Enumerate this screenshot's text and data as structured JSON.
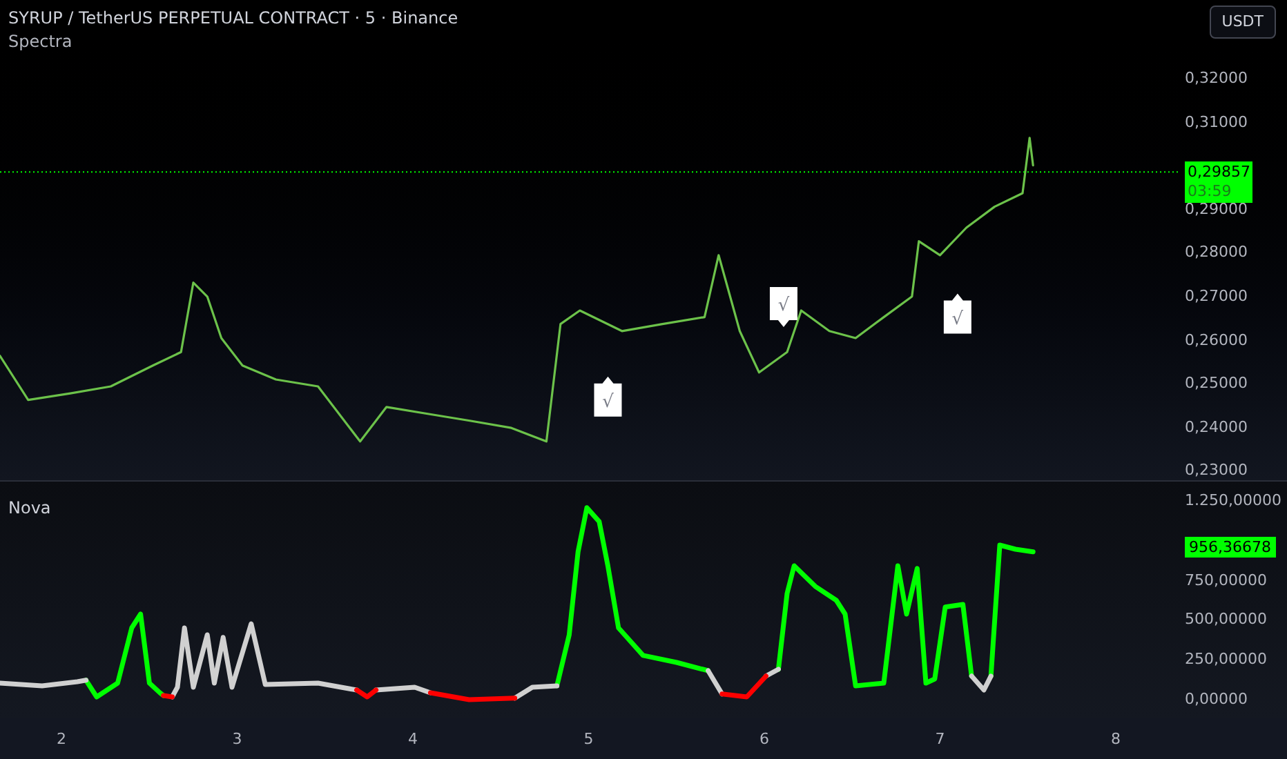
{
  "header": {
    "title": "SYRUP / TetherUS PERPETUAL CONTRACT · 5 · Binance",
    "indicator": "Spectra",
    "currency_button": "USDT"
  },
  "price_pane": {
    "chart_data": {
      "type": "line",
      "x": [
        1.65,
        1.81,
        2.05,
        2.28,
        2.52,
        2.68,
        2.75,
        2.83,
        2.91,
        3.03,
        3.22,
        3.46,
        3.7,
        3.85,
        4.09,
        4.33,
        4.56,
        4.76,
        4.84,
        4.95,
        5.19,
        5.42,
        5.66,
        5.74,
        5.86,
        5.97,
        6.13,
        6.21,
        6.37,
        6.52,
        6.68,
        6.84,
        6.88,
        7.0,
        7.15,
        7.31,
        7.47,
        7.51,
        7.53
      ],
      "series": [
        {
          "color": "#6cc24a",
          "values": [
            0.2564,
            0.2463,
            0.2478,
            0.2494,
            0.2542,
            0.2573,
            0.2732,
            0.27,
            0.2605,
            0.2542,
            0.251,
            0.2494,
            0.2368,
            0.2447,
            0.2431,
            0.2415,
            0.2399,
            0.2368,
            0.2637,
            0.2668,
            0.2621,
            0.2637,
            0.2653,
            0.2795,
            0.2621,
            0.2526,
            0.2573,
            0.2668,
            0.2621,
            0.2605,
            0.2653,
            0.27,
            0.2827,
            0.2795,
            0.2858,
            0.2906,
            0.2937,
            0.3064,
            0.3001
          ]
        }
      ],
      "xlim": [
        1.65,
        8.975
      ],
      "ylim": [
        0.2279,
        0.338
      ],
      "ref_lines": [
        {
          "axis": "y",
          "value": 0.29857,
          "color": "#00ff00"
        }
      ],
      "yticks": [
        {
          "value": 0.32,
          "label": "0,32000"
        },
        {
          "value": 0.31,
          "label": "0,31000"
        },
        {
          "value": 0.29,
          "label": "0,29000"
        },
        {
          "value": 0.28,
          "label": "0,28000"
        },
        {
          "value": 0.27,
          "label": "0,27000"
        },
        {
          "value": 0.26,
          "label": "0,26000"
        },
        {
          "value": 0.25,
          "label": "0,25000"
        },
        {
          "value": 0.24,
          "label": "0,24000"
        },
        {
          "value": 0.23,
          "label": "0,23000"
        }
      ]
    },
    "price_badge": {
      "value": "0,29857",
      "countdown": "03:59",
      "color": "#00ff00"
    },
    "signals": [
      {
        "kind": "up",
        "text": "√"
      },
      {
        "kind": "down",
        "text": "√"
      },
      {
        "kind": "up",
        "text": "√"
      }
    ]
  },
  "indicator_pane": {
    "title": "Nova",
    "chart_data": {
      "type": "line",
      "x": [
        1.65,
        1.89,
        2.09,
        2.14,
        2.2,
        2.32,
        2.4,
        2.45,
        2.5,
        2.56,
        2.58,
        2.63,
        2.66,
        2.7,
        2.75,
        2.83,
        2.87,
        2.92,
        2.97,
        3.08,
        3.16,
        3.46,
        3.68,
        3.74,
        3.79,
        4.01,
        4.1,
        4.32,
        4.58,
        4.68,
        4.82,
        4.89,
        4.94,
        4.99,
        5.06,
        5.11,
        5.17,
        5.31,
        5.5,
        5.68,
        5.76,
        5.9,
        6.01,
        6.08,
        6.13,
        6.17,
        6.29,
        6.41,
        6.46,
        6.52,
        6.68,
        6.76,
        6.81,
        6.87,
        6.92,
        6.97,
        7.03,
        7.13,
        7.18,
        7.25,
        7.29,
        7.34,
        7.43,
        7.53
      ],
      "series": [
        {
          "color": "#00ff00",
          "values": [
            null,
            null,
            null,
            122,
            17,
            104,
            451,
            538,
            104,
            43,
            26,
            null,
            null,
            null,
            null,
            null,
            null,
            null,
            null,
            null,
            null,
            null,
            null,
            null,
            null,
            null,
            null,
            null,
            null,
            null,
            87,
            408,
            929,
            1207,
            1120,
            842,
            451,
            278,
            234,
            182,
            null,
            null,
            null,
            191,
            668,
            842,
            712,
            625,
            538,
            87,
            104,
            842,
            538,
            825,
            104,
            130,
            582,
            599,
            148,
            null,
            148,
            972,
            946,
            929
          ]
        },
        {
          "color": "#d0d0d0",
          "values": [
            104,
            87,
            113,
            122,
            null,
            null,
            null,
            null,
            null,
            null,
            null,
            17,
            78,
            451,
            78,
            408,
            104,
            391,
            78,
            477,
            95,
            104,
            61,
            null,
            61,
            78,
            43,
            null,
            9,
            78,
            87,
            null,
            null,
            null,
            null,
            null,
            null,
            null,
            null,
            182,
            35,
            null,
            148,
            191,
            null,
            null,
            null,
            null,
            null,
            null,
            null,
            null,
            null,
            null,
            null,
            null,
            null,
            null,
            148,
            61,
            148,
            null,
            null,
            null
          ]
        },
        {
          "color": "#ff0000",
          "values": [
            null,
            null,
            null,
            null,
            null,
            null,
            null,
            null,
            null,
            null,
            26,
            17,
            null,
            null,
            null,
            null,
            null,
            null,
            null,
            null,
            null,
            null,
            61,
            17,
            61,
            null,
            43,
            0,
            9,
            null,
            null,
            null,
            null,
            null,
            null,
            null,
            null,
            null,
            null,
            null,
            35,
            17,
            148,
            null,
            null,
            null,
            null,
            null,
            null,
            null,
            null,
            null,
            null,
            null,
            null,
            null,
            null,
            null,
            null,
            null,
            null,
            null,
            null,
            null
          ]
        }
      ],
      "xlim": [
        1.65,
        8.975
      ],
      "ylim": [
        -113,
        1371
      ],
      "xticks": [
        {
          "value": 2,
          "label": "2"
        },
        {
          "value": 3,
          "label": "3"
        },
        {
          "value": 4,
          "label": "4"
        },
        {
          "value": 5,
          "label": "5"
        },
        {
          "value": 6,
          "label": "6"
        },
        {
          "value": 7,
          "label": "7"
        },
        {
          "value": 8,
          "label": "8"
        }
      ],
      "yticks": [
        {
          "value": 1250,
          "label": "1.250,00000"
        },
        {
          "value": 750,
          "label": "750,00000"
        },
        {
          "value": 500,
          "label": "500,00000"
        },
        {
          "value": 250,
          "label": "250,00000"
        },
        {
          "value": 0,
          "label": "0,00000"
        }
      ]
    },
    "value_badge": {
      "value": "956,36678",
      "color": "#00ff00"
    }
  }
}
